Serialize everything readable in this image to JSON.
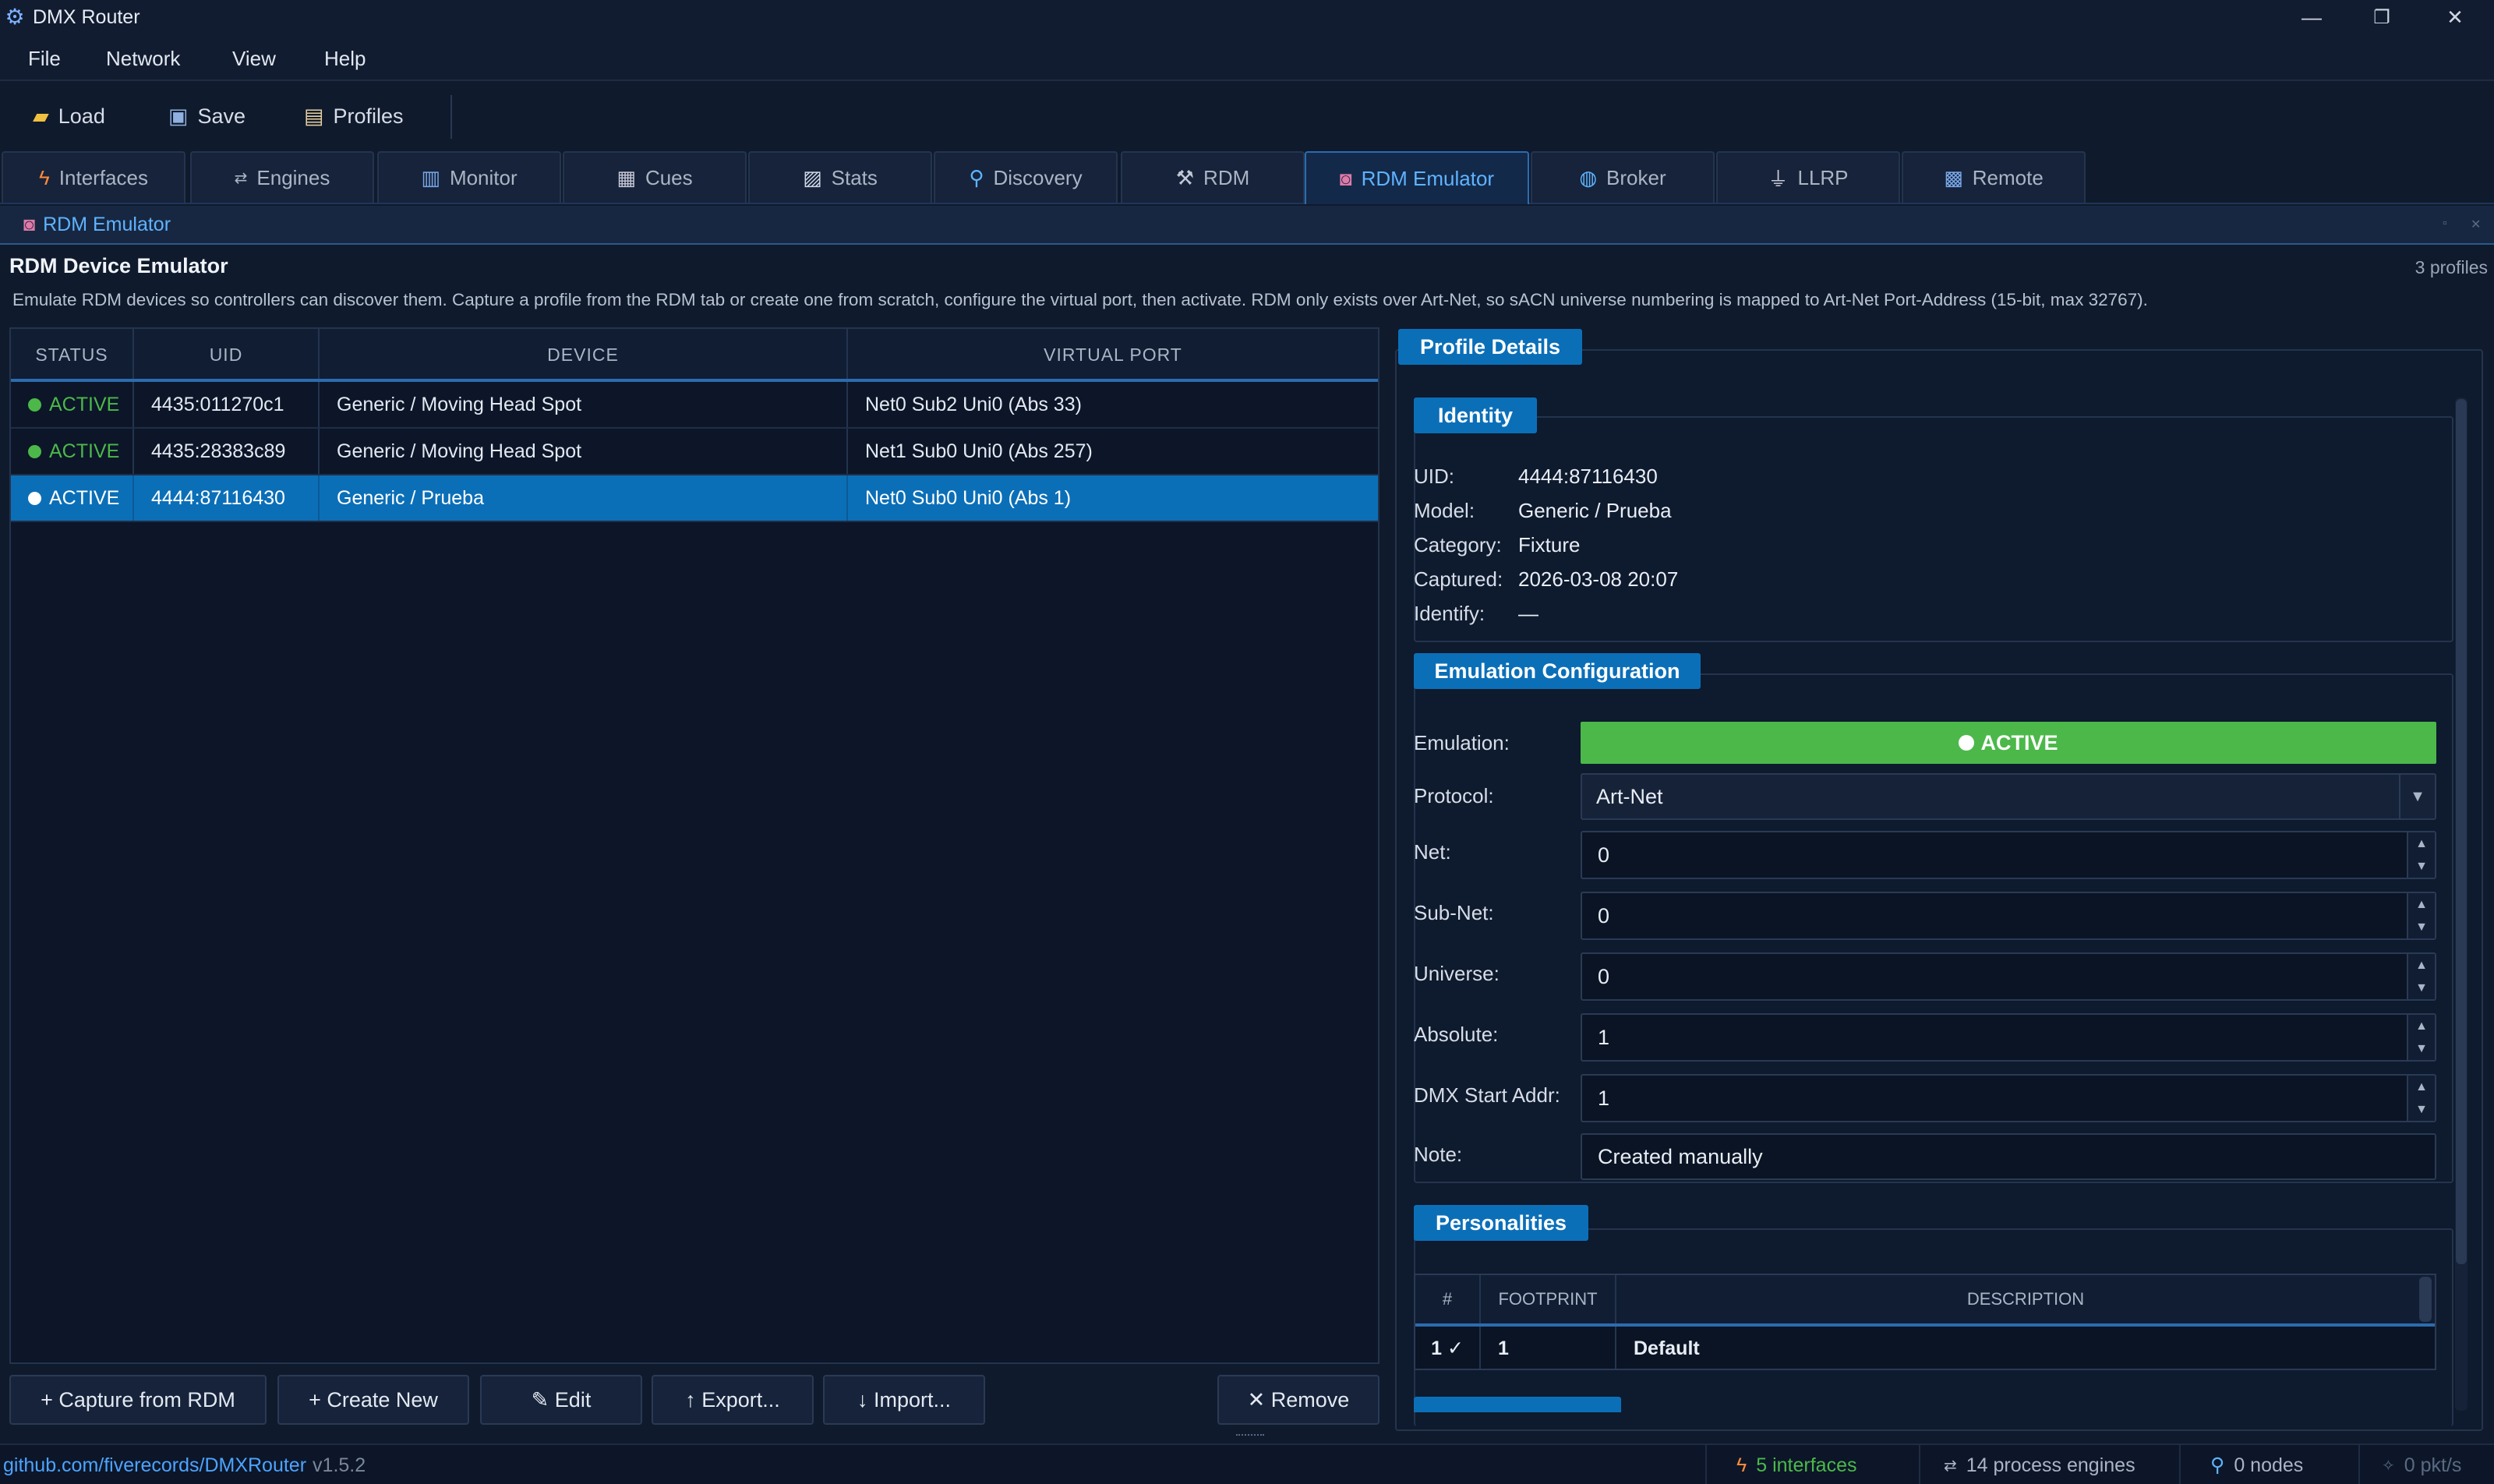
{
  "window": {
    "title": "DMX Router",
    "minimize": "—",
    "restore": "❐",
    "close": "✕"
  },
  "menu": [
    {
      "label": "File"
    },
    {
      "label": "Network"
    },
    {
      "label": "View"
    },
    {
      "label": "Help"
    }
  ],
  "toolbar": {
    "load": "Load",
    "save": "Save",
    "profiles": "Profiles"
  },
  "tabs": [
    {
      "label": "Interfaces",
      "icon": "lightning-icon"
    },
    {
      "label": "Engines",
      "icon": "arrows-icon"
    },
    {
      "label": "Monitor",
      "icon": "bar-chart-icon"
    },
    {
      "label": "Cues",
      "icon": "clapper-icon"
    },
    {
      "label": "Stats",
      "icon": "chart-icon"
    },
    {
      "label": "Discovery",
      "icon": "magnifier-icon"
    },
    {
      "label": "RDM",
      "icon": "wrench-icon"
    },
    {
      "label": "RDM Emulator",
      "icon": "robot-icon",
      "active": true
    },
    {
      "label": "Broker",
      "icon": "globe-icon"
    },
    {
      "label": "LLRP",
      "icon": "plug-icon"
    },
    {
      "label": "Remote",
      "icon": "grid-icon"
    }
  ],
  "panel_header": {
    "label": "RDM Emulator"
  },
  "page": {
    "title": "RDM Device Emulator",
    "count": "3 profiles",
    "description": "Emulate RDM devices so controllers can discover them. Capture a profile from the RDM tab or create one from scratch, configure the virtual port, then activate. RDM only exists over Art-Net, so sACN universe numbering is mapped to Art-Net Port-Address (15-bit, max 32767)."
  },
  "table": {
    "columns": [
      "STATUS",
      "UID",
      "DEVICE",
      "VIRTUAL PORT"
    ],
    "rows": [
      {
        "status": "ACTIVE",
        "uid": "4435:011270c1",
        "device": "Generic / Moving Head Spot",
        "port": "Net0 Sub2 Uni0 (Abs 33)",
        "selected": false
      },
      {
        "status": "ACTIVE",
        "uid": "4435:28383c89",
        "device": "Generic / Moving Head Spot",
        "port": "Net1 Sub0 Uni0 (Abs 257)",
        "selected": false
      },
      {
        "status": "ACTIVE",
        "uid": "4444:87116430",
        "device": "Generic / Prueba",
        "port": "Net0 Sub0 Uni0 (Abs 1)",
        "selected": true
      }
    ]
  },
  "buttons": {
    "capture": "+ Capture from RDM",
    "create": "+ Create New",
    "edit": "✎ Edit",
    "export": "↑ Export...",
    "import": "↓ Import...",
    "remove": "✕ Remove"
  },
  "details": {
    "title": "Profile Details",
    "identity": {
      "title": "Identity",
      "uid_label": "UID:",
      "uid": "4444:87116430",
      "model_label": "Model:",
      "model": "Generic / Prueba",
      "category_label": "Category:",
      "category": "Fixture",
      "captured_label": "Captured:",
      "captured": "2026-03-08 20:07",
      "identify_label": "Identify:",
      "identify": "—"
    },
    "emulation": {
      "title": "Emulation Configuration",
      "emulation_label": "Emulation:",
      "emulation_state": "ACTIVE",
      "protocol_label": "Protocol:",
      "protocol": "Art-Net",
      "net_label": "Net:",
      "net": "0",
      "subnet_label": "Sub-Net:",
      "subnet": "0",
      "universe_label": "Universe:",
      "universe": "0",
      "absolute_label": "Absolute:",
      "absolute": "1",
      "dmx_label": "DMX Start Addr:",
      "dmx": "1",
      "note_label": "Note:",
      "note": "Created manually"
    },
    "personalities": {
      "title": "Personalities",
      "columns": [
        "#",
        "FOOTPRINT",
        "DESCRIPTION"
      ],
      "rows": [
        {
          "num": "1 ✓",
          "footprint": "1",
          "description": "Default"
        }
      ]
    }
  },
  "status": {
    "link": "github.com/fiverecords/DMXRouter",
    "version": "v1.5.2",
    "interfaces": "5 interfaces",
    "engines": "14 process engines",
    "nodes": "0 nodes",
    "pkts": "0 pkt/s"
  },
  "colors": {
    "accent": "#0b6fb8",
    "active_green": "#4cb84a",
    "link_blue": "#4da3ff",
    "background": "#0f1a2c"
  }
}
